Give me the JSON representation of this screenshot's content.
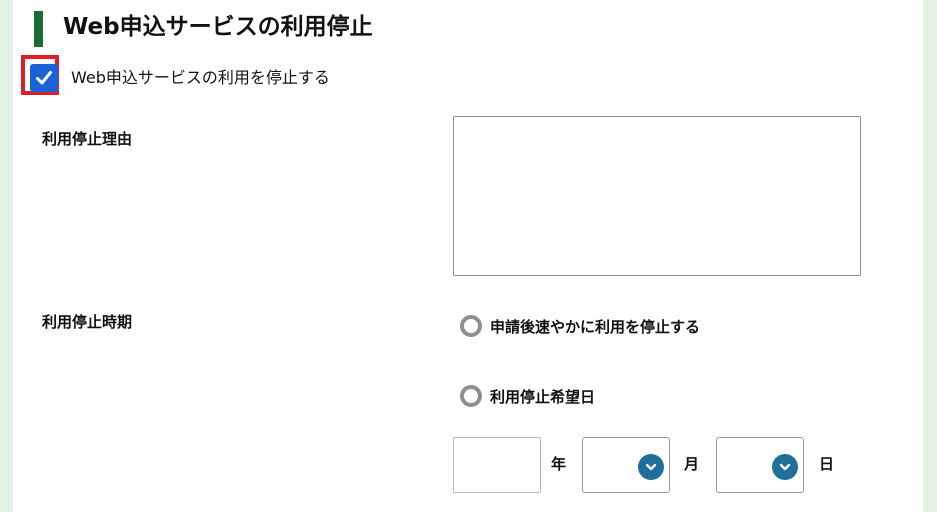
{
  "section": {
    "title": "Web申込サービスの利用停止"
  },
  "stop_checkbox": {
    "label": "Web申込サービスの利用を停止する",
    "checked": true
  },
  "reason": {
    "label": "利用停止理由",
    "value": ""
  },
  "timing": {
    "label": "利用停止時期",
    "options": [
      {
        "label": "申請後速やかに利用を停止する",
        "selected": false
      },
      {
        "label": "利用停止希望日",
        "selected": false
      }
    ]
  },
  "date": {
    "year_value": "",
    "year_unit": "年",
    "month_value": "",
    "month_unit": "月",
    "day_value": "",
    "day_unit": "日"
  },
  "colors": {
    "accent_bar": "#1b6b34",
    "checkbox": "#1a63d6",
    "highlight": "#e21c23",
    "select_chevron": "#1f6f9b",
    "page_background": "#e3f2e3"
  },
  "icons": {
    "checkbox": "check-icon",
    "select": "chevron-down-icon"
  }
}
